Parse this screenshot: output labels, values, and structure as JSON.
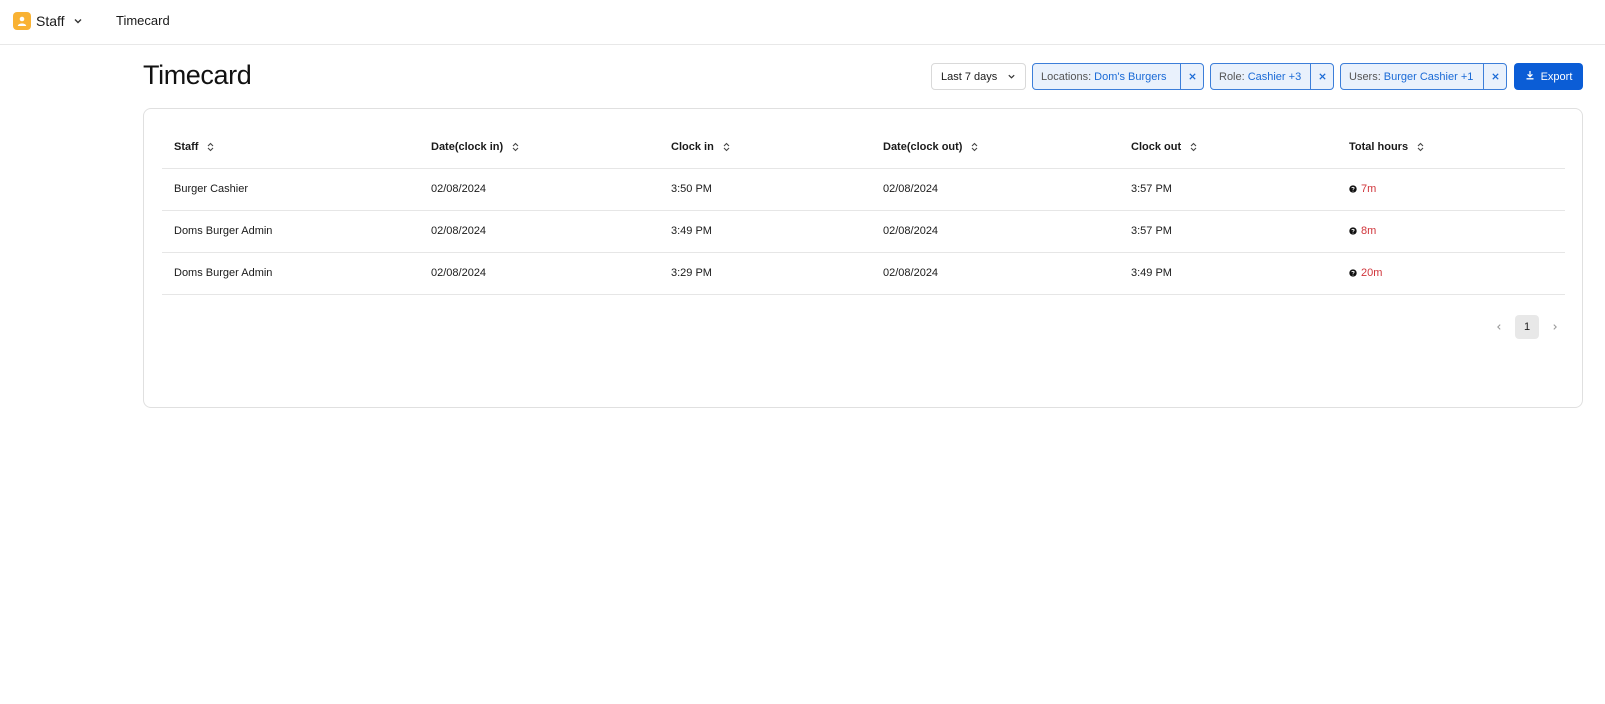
{
  "topbar": {
    "app_name": "Staff",
    "page_label": "Timecard"
  },
  "header": {
    "title": "Timecard",
    "date_range": "Last 7 days",
    "filters": [
      {
        "key": "Locations:",
        "value": "Dom's Burgers"
      },
      {
        "key": "Role:",
        "value": "Cashier +3"
      },
      {
        "key": "Users:",
        "value": "Burger Cashier +1"
      }
    ],
    "export_label": "Export"
  },
  "table": {
    "columns": [
      "Staff",
      "Date(clock in)",
      "Clock in",
      "Date(clock out)",
      "Clock out",
      "Total hours"
    ],
    "rows": [
      {
        "staff": "Burger Cashier",
        "date_in": "02/08/2024",
        "clock_in": "3:50 PM",
        "date_out": "02/08/2024",
        "clock_out": "3:57 PM",
        "total": "7m"
      },
      {
        "staff": "Doms Burger Admin",
        "date_in": "02/08/2024",
        "clock_in": "3:49 PM",
        "date_out": "02/08/2024",
        "clock_out": "3:57 PM",
        "total": "8m"
      },
      {
        "staff": "Doms Burger Admin",
        "date_in": "02/08/2024",
        "clock_in": "3:29 PM",
        "date_out": "02/08/2024",
        "clock_out": "3:49 PM",
        "total": "20m"
      }
    ]
  },
  "pagination": {
    "current_page": "1"
  },
  "colors": {
    "accent": "#0b5dd6",
    "chip_border": "#3c7ed9",
    "chip_bg": "#e9f1fc",
    "hours_red": "#d0343a",
    "app_icon": "#f9b233"
  },
  "icons": {
    "app": "user-icon",
    "sort": "sort-icon",
    "remove": "close-icon",
    "export": "download-icon",
    "hours": "question-icon"
  }
}
